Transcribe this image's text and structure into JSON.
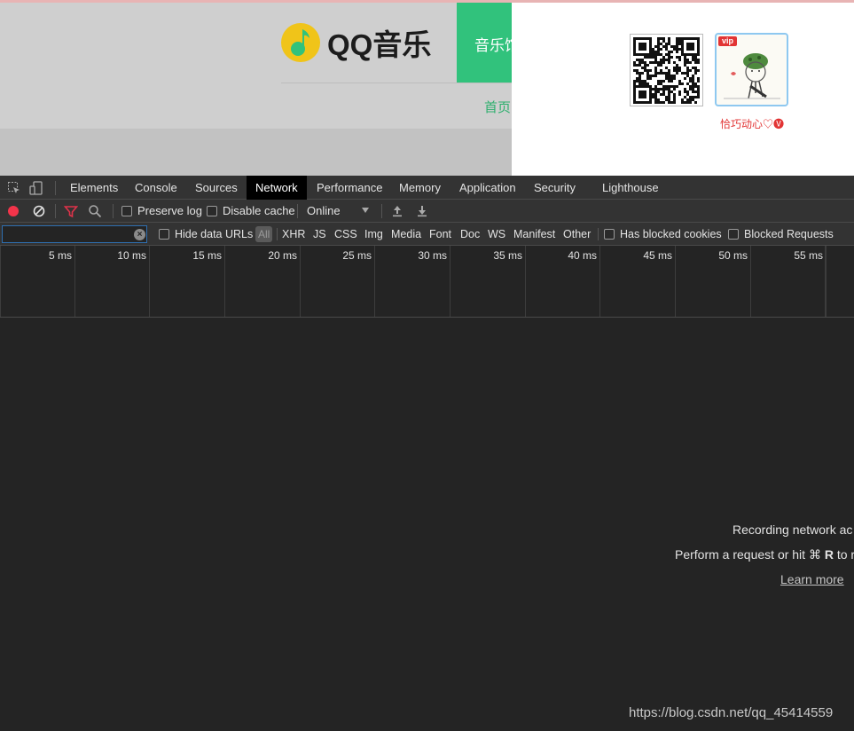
{
  "page": {
    "logo_text": "QQ音乐",
    "nav_active_label": "音乐馆",
    "home_link": "首页",
    "popup": {
      "vip_badge": "vip",
      "nickname": "恰巧动心♡🅥"
    }
  },
  "devtools": {
    "tabs": [
      "Elements",
      "Console",
      "Sources",
      "Network",
      "Performance",
      "Memory",
      "Application",
      "Security",
      "Lighthouse"
    ],
    "active_tab": "Network",
    "toolbar": {
      "preserve_log": "Preserve log",
      "disable_cache": "Disable cache",
      "throttling": "Online"
    },
    "filter": {
      "value": "",
      "placeholder": "",
      "hide_data_urls": "Hide data URLs",
      "all": "All",
      "types": [
        "XHR",
        "JS",
        "CSS",
        "Img",
        "Media",
        "Font",
        "Doc",
        "WS",
        "Manifest",
        "Other"
      ],
      "has_blocked_cookies": "Has blocked cookies",
      "blocked_requests": "Blocked Requests"
    },
    "timeline_ticks": [
      "5 ms",
      "10 ms",
      "15 ms",
      "20 ms",
      "25 ms",
      "30 ms",
      "35 ms",
      "40 ms",
      "45 ms",
      "50 ms",
      "55 ms"
    ],
    "empty_state": {
      "line1": "Recording network ac",
      "line2_prefix": "Perform a request or hit ⌘ ",
      "line2_key": "R",
      "line2_suffix": " to r",
      "learn_more": "Learn more"
    }
  },
  "watermark": "https://blog.csdn.net/qq_45414559",
  "colors": {
    "qq_green": "#31c27c",
    "qq_yellow": "#f0c419",
    "record_red": "#f3344a",
    "filter_red": "#e0334a",
    "devtools_bg": "#242424",
    "devtools_bar": "#333333"
  },
  "icons": {
    "inspect": "inspect-element-icon",
    "device": "device-toolbar-icon",
    "record": "record-icon",
    "clear": "clear-icon",
    "filter": "filter-icon",
    "search": "search-icon",
    "import": "import-har-icon",
    "export": "export-har-icon"
  }
}
